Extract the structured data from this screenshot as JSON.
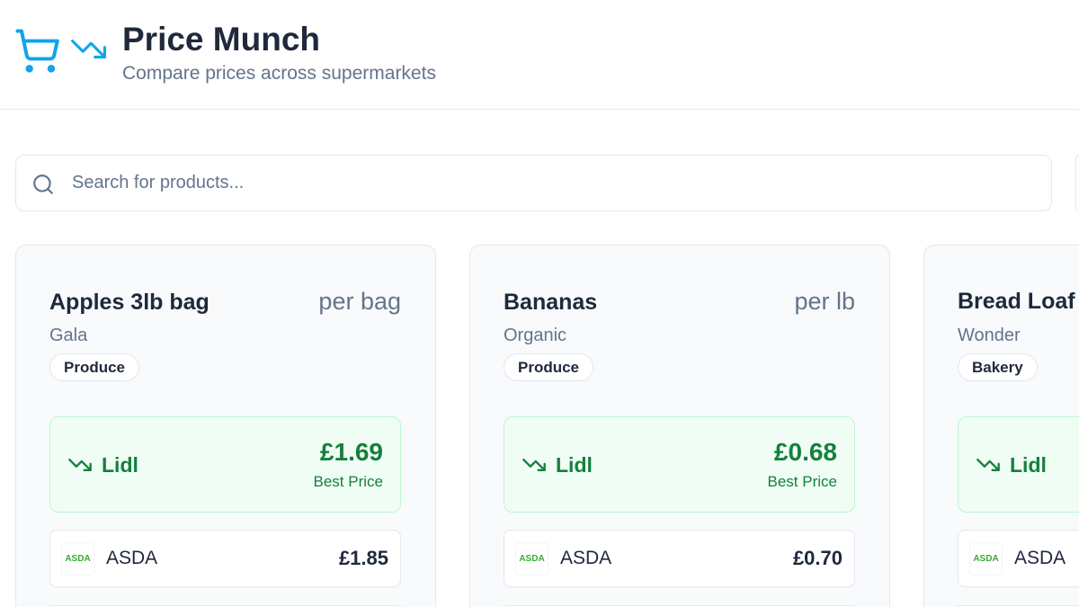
{
  "app": {
    "title": "Price Munch",
    "subtitle": "Compare prices across supermarkets",
    "logo_icon": "shopping-cart-icon",
    "trend_icon": "trending-down-icon"
  },
  "search": {
    "placeholder": "Search for products...",
    "value": "",
    "icon": "search-icon"
  },
  "colors": {
    "accent": "#0ea5e9",
    "best_green": "#15803d",
    "best_bg": "#f0fdf4",
    "best_border": "#bbf7d0",
    "asda_green": "#3aaa35"
  },
  "products": [
    {
      "name": "Apples 3lb bag",
      "unit": "per bag",
      "variety": "Gala",
      "category": "Produce",
      "best": {
        "icon": "trending-down-icon",
        "store": "Lidl",
        "price": "£1.69",
        "label": "Best Price"
      },
      "stores": [
        {
          "logo_text": "ASDA",
          "name": "ASDA",
          "price": "£1.85"
        }
      ]
    },
    {
      "name": "Bananas",
      "unit": "per lb",
      "variety": "Organic",
      "category": "Produce",
      "best": {
        "icon": "trending-down-icon",
        "store": "Lidl",
        "price": "£0.68",
        "label": "Best Price"
      },
      "stores": [
        {
          "logo_text": "ASDA",
          "name": "ASDA",
          "price": "£0.70"
        }
      ]
    },
    {
      "name": "Bread Loaf",
      "variety": "Wonder",
      "category": "Bakery",
      "best": {
        "icon": "trending-down-icon",
        "store": "Lidl"
      },
      "stores": [
        {
          "logo_text": "ASDA",
          "name": "ASDA"
        }
      ]
    }
  ]
}
